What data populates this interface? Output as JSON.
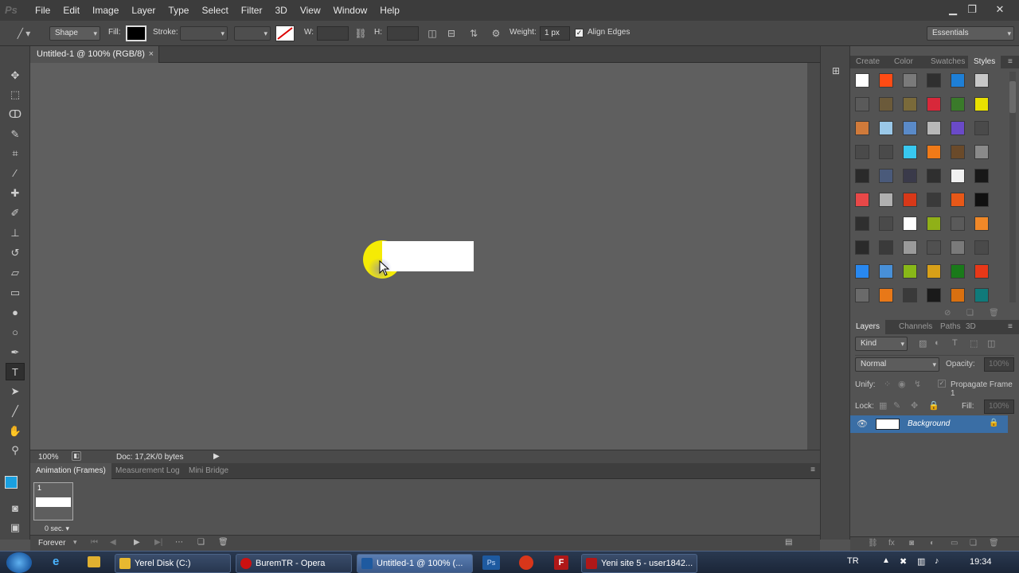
{
  "menubar": {
    "logo": "Ps",
    "items": [
      "File",
      "Edit",
      "Image",
      "Layer",
      "Type",
      "Select",
      "Filter",
      "3D",
      "View",
      "Window",
      "Help"
    ]
  },
  "options": {
    "mode": "Shape",
    "fill_label": "Fill:",
    "stroke_label": "Stroke:",
    "w_label": "W:",
    "h_label": "H:",
    "weight_label": "Weight:",
    "weight_value": "1 px",
    "align_edges": "Align Edges",
    "workspace": "Essentials"
  },
  "document": {
    "tab_title": "Untitled-1 @ 100% (RGB/8)",
    "close": "×",
    "zoom": "100%",
    "doc_info": "Doc: 17,2K/0 bytes"
  },
  "bottom_panel": {
    "tabs": [
      "Animation (Frames)",
      "Measurement Log",
      "Mini Bridge"
    ],
    "frame_number": "1",
    "frame_delay": "0 sec.",
    "loop": "Forever"
  },
  "styles_panel": {
    "tabs": [
      "Create",
      "Color",
      "Swatches",
      "Styles"
    ],
    "swatch_colors": [
      "#ffffff",
      "#ff4b14",
      "#7a7a7a",
      "#2f2f2f",
      "#1e7fd6",
      "#c8c8c8",
      "#5a5a5a",
      "#6b5a3a",
      "#7a6a3a",
      "#d8283a",
      "#3a7a2a",
      "#e8e000",
      "#d07a3a",
      "#9ac8e8",
      "#5a8ac8",
      "#b8b8b8",
      "#6a4ac8",
      "#4a4a4a",
      "#4a4a4a",
      "#4a4a4a",
      "#38c8f0",
      "#f07a18",
      "#6a4a2a",
      "#8a8a8a",
      "#2a2a2a",
      "#4a5a7a",
      "#3a3a4a",
      "#2f2f2f",
      "#f0f0f0",
      "#181818",
      "#e84848",
      "#b0b0b0",
      "#d83818",
      "#3a3a3a",
      "#e85818",
      "#101010",
      "#2f2f2f",
      "#4a4a4a",
      "#ffffff",
      "#90b018",
      "#5a5a5a",
      "#f08828",
      "#2a2a2a",
      "#3a3a3a",
      "#9a9a9a",
      "#505050",
      "#7a7a7a",
      "#4a4a4a",
      "#2888f0",
      "#4890d8",
      "#88b818",
      "#d8a018",
      "#1a7a1a",
      "#e83818",
      "#6a6a6a",
      "#e87818",
      "#3a3a3a",
      "#1a1a1a",
      "#d87010",
      "#107a7a"
    ]
  },
  "layers_panel": {
    "tabs": [
      "Layers",
      "Channels",
      "Paths",
      "3D"
    ],
    "kind": "Kind",
    "blend_mode": "Normal",
    "opacity_label": "Opacity:",
    "opacity_value": "100%",
    "unify_label": "Unify:",
    "propagate": "Propagate Frame 1",
    "lock_label": "Lock:",
    "fill_label": "Fill:",
    "fill_value": "100%",
    "layer_name": "Background"
  },
  "taskbar": {
    "buttons": [
      {
        "label": "Yerel Disk (C:)",
        "color": "#e8b830"
      },
      {
        "label": "BuremTR - Opera",
        "color": "#cc1111"
      },
      {
        "label": "Untitled-1 @ 100% (...",
        "color": "#1e5aa0"
      },
      {
        "label": "Yeni site 5 - user1842...",
        "color": "#b01818"
      }
    ],
    "lang": "TR",
    "time": "19:34"
  }
}
